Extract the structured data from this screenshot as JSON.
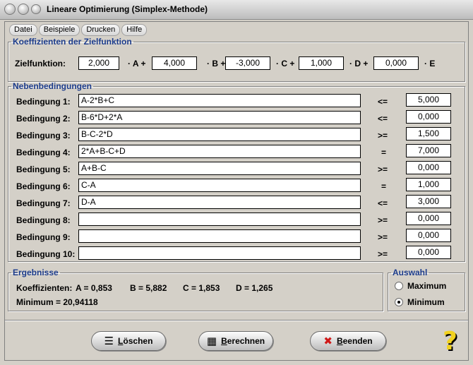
{
  "window": {
    "title": "Lineare Optimierung (Simplex-Methode)"
  },
  "menu": [
    "Datei",
    "Beispiele",
    "Drucken",
    "Hilfe"
  ],
  "objective": {
    "legend": "Koeffizienten der Zielfunktion",
    "label": "Zielfunktion:",
    "coefficients": [
      "2,000",
      "4,000",
      "-3,000",
      "1,000",
      "0,000"
    ],
    "terms": [
      "· A +",
      "· B +",
      "· C +",
      "· D +",
      "· E"
    ]
  },
  "constraints": {
    "legend": "Nebenbedingungen",
    "rows": [
      {
        "label": "Bedingung 1:",
        "expr": "A-2*B+C",
        "op": "<=",
        "rhs": "5,000"
      },
      {
        "label": "Bedingung 2:",
        "expr": "B-6*D+2*A",
        "op": "<=",
        "rhs": "0,000"
      },
      {
        "label": "Bedingung 3:",
        "expr": "B-C-2*D",
        "op": ">=",
        "rhs": "1,500"
      },
      {
        "label": "Bedingung 4:",
        "expr": "2*A+B-C+D",
        "op": "=",
        "rhs": "7,000"
      },
      {
        "label": "Bedingung 5:",
        "expr": "A+B-C",
        "op": ">=",
        "rhs": "0,000"
      },
      {
        "label": "Bedingung 6:",
        "expr": "C-A",
        "op": "=",
        "rhs": "1,000"
      },
      {
        "label": "Bedingung 7:",
        "expr": "D-A",
        "op": "<=",
        "rhs": "3,000"
      },
      {
        "label": "Bedingung 8:",
        "expr": "",
        "op": ">=",
        "rhs": "0,000"
      },
      {
        "label": "Bedingung 9:",
        "expr": "",
        "op": ">=",
        "rhs": "0,000"
      },
      {
        "label": "Bedingung 10:",
        "expr": "",
        "op": ">=",
        "rhs": "0,000"
      }
    ]
  },
  "results": {
    "legend": "Ergebnisse",
    "coefficients_label": "Koeffizienten:",
    "values": [
      "A = 0,853",
      "B = 5,882",
      "C = 1,853",
      "D = 1,265"
    ],
    "minimum": "Minimum = 20,94118"
  },
  "selection": {
    "legend": "Auswahl",
    "options": [
      "Maximum",
      "Minimum"
    ],
    "selected": "Minimum"
  },
  "buttons": {
    "clear_pre": "",
    "clear_key": "L",
    "clear_rest": "öschen",
    "calc_pre": "",
    "calc_key": "B",
    "calc_rest": "erechnen",
    "exit_pre": "",
    "exit_key": "B",
    "exit_rest": "eenden"
  },
  "icons": {
    "clear": "list-arrow-icon",
    "calc": "calculator-icon",
    "exit": "red-x-icon",
    "help": "question-mark-icon"
  },
  "colors": {
    "legend": "#1c3c8c",
    "exit_icon": "#d01818",
    "help_icon": "#f2d21e"
  }
}
